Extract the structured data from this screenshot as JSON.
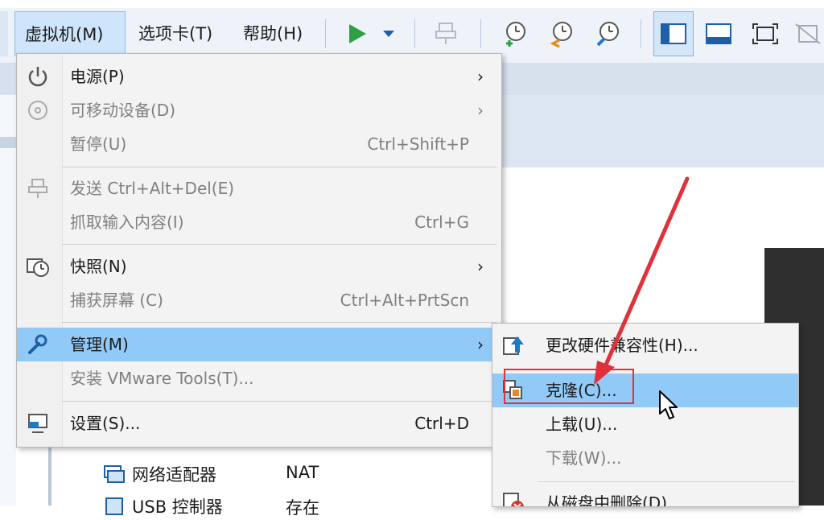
{
  "menubar": {
    "vm_menu": "虚拟机(M)",
    "tabs_menu": "选项卡(T)",
    "help_menu": "帮助(H)"
  },
  "toolbar": {
    "play_icon": "play-icon",
    "dropdown_icon": "chevron-down-icon",
    "accent": "#2ea043"
  },
  "vm_menu": {
    "items": [
      {
        "label": "电源(P)",
        "shortcut": "",
        "submenu": true,
        "disabled": false,
        "icon": "power-icon"
      },
      {
        "label": "可移动设备(D)",
        "shortcut": "",
        "submenu": true,
        "disabled": true,
        "icon": "cd-icon"
      },
      {
        "label": "暂停(U)",
        "shortcut": "Ctrl+Shift+P",
        "submenu": false,
        "disabled": true,
        "icon": ""
      },
      {
        "label": "发送 Ctrl+Alt+Del(E)",
        "shortcut": "",
        "submenu": false,
        "disabled": true,
        "icon": "send-keys-icon"
      },
      {
        "label": "抓取输入内容(I)",
        "shortcut": "Ctrl+G",
        "submenu": false,
        "disabled": true,
        "icon": ""
      },
      {
        "label": "快照(N)",
        "shortcut": "",
        "submenu": true,
        "disabled": false,
        "icon": "snapshot-icon"
      },
      {
        "label": "捕获屏幕 (C)",
        "shortcut": "Ctrl+Alt+PrtScn",
        "submenu": false,
        "disabled": true,
        "icon": ""
      },
      {
        "label": "管理(M)",
        "shortcut": "",
        "submenu": true,
        "disabled": false,
        "highlighted": true,
        "icon": "wrench-icon"
      },
      {
        "label": "安装 VMware Tools(T)...",
        "shortcut": "",
        "submenu": false,
        "disabled": true,
        "icon": ""
      },
      {
        "label": "设置(S)...",
        "shortcut": "Ctrl+D",
        "submenu": false,
        "disabled": false,
        "icon": "settings-icon"
      }
    ]
  },
  "manage_submenu": {
    "items": [
      {
        "label": "更改硬件兼容性(H)...",
        "disabled": false,
        "icon": "upgrade-icon"
      },
      {
        "label": "克隆(C)...",
        "disabled": false,
        "highlighted": true,
        "icon": "clone-icon"
      },
      {
        "label": "上载(U)...",
        "disabled": false,
        "icon": ""
      },
      {
        "label": "下载(W)...",
        "disabled": true,
        "icon": ""
      },
      {
        "label": "从磁盘中删除(D)",
        "disabled": false,
        "icon": "delete-icon"
      }
    ]
  },
  "devices": [
    {
      "name": "网络适配器",
      "value": "NAT",
      "icon": "network-adapter-icon"
    },
    {
      "name": "USB 控制器",
      "value": "存在",
      "icon": "usb-icon"
    }
  ]
}
